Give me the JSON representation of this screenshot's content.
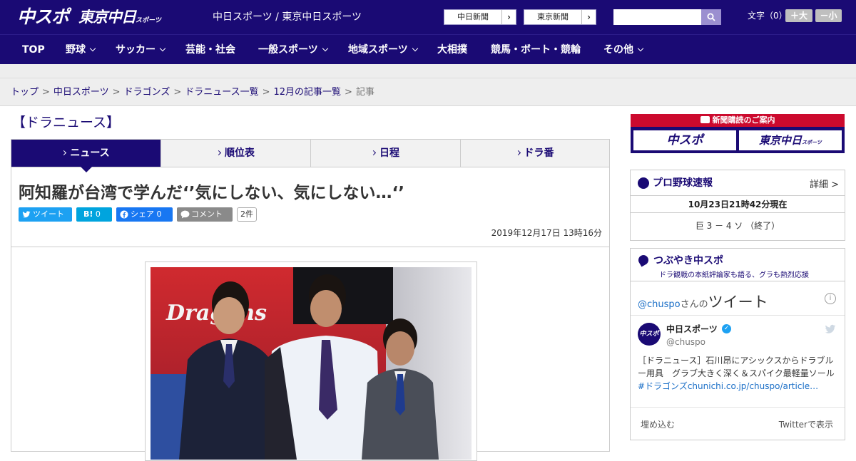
{
  "header": {
    "logo_chuspo": "中スポ",
    "logo_tokyo": "東京中日",
    "logo_tokyo_small": "スポーツ",
    "site_name": "中日スポーツ / 東京中日スポーツ",
    "news_links": [
      "中日新聞",
      "東京新聞"
    ],
    "search": {
      "placeholder": "",
      "value": ""
    },
    "font_size_label": "文字（0）",
    "font_bigger": "＋大",
    "font_smaller": "－小"
  },
  "nav": {
    "items": [
      {
        "label": "TOP"
      },
      {
        "label": "野球"
      },
      {
        "label": "サッカー"
      },
      {
        "label": "芸能・社会"
      },
      {
        "label": "一般スポーツ"
      },
      {
        "label": "地域スポーツ"
      },
      {
        "label": "大相撲"
      },
      {
        "label": "競馬・ボート・競輪"
      },
      {
        "label": "その他"
      }
    ]
  },
  "breadcrumb": {
    "items": [
      "トップ",
      "中日スポーツ",
      "ドラゴンズ",
      "ドラニュース一覧",
      "12月の記事一覧"
    ],
    "current": "記事",
    "separator": ">"
  },
  "section": {
    "title": "【ドラニュース】"
  },
  "tabs": [
    {
      "label": "ニュース",
      "active": true
    },
    {
      "label": "順位表",
      "active": false
    },
    {
      "label": "日程",
      "active": false
    },
    {
      "label": "ドラ番",
      "active": false
    }
  ],
  "article": {
    "headline": "阿知羅が台湾で学んだ‘’気にしない、気にしない…‘’",
    "share": {
      "tweet": "ツイート",
      "hatena_icon": "B!",
      "hatena_count": "0",
      "facebook": "シェア 0",
      "comment": "コメント",
      "comment_count": "2件"
    },
    "date": "2019年12月17日 13時16分",
    "photo_banner_text": "Dragons"
  },
  "sidebar": {
    "subscription": {
      "title": "新聞購読のご案内",
      "logo_left": "中スポ",
      "logo_right": "東京中日",
      "logo_right_small": "スポーツ"
    },
    "baseball": {
      "title": "プロ野球速報",
      "detail_link": "詳細 >",
      "as_of": "10月23日21時42分現在",
      "score": "巨 3 － 4 ソ （終了）"
    },
    "tweets": {
      "title": "つぶやき中スポ",
      "subtitle": "ドラ観戦の本紙評論家も語る、グラも熱烈応援",
      "handle_link": "@chuspo",
      "handle_suffix": "さんの",
      "heading": "ツイート",
      "account_name": "中日スポーツ",
      "account_handle": "@chuspo",
      "avatar_text": "中スポ",
      "tweet_text": "［ドラニュース］石川昂にアシックスからドラブルー用具　グラブ大きく深く＆スパイク最軽量ソール",
      "tweet_link": "#ドラゴンズchunichi.co.jp/chuspo/article…",
      "embed": "埋め込む",
      "view_on_twitter": "Twitterで表示"
    }
  },
  "colors": {
    "brand": "#1a0a74",
    "accent_red": "#cc0a2e",
    "twitter": "#1da1f2",
    "hatena": "#00a4de",
    "facebook": "#1877f2"
  }
}
